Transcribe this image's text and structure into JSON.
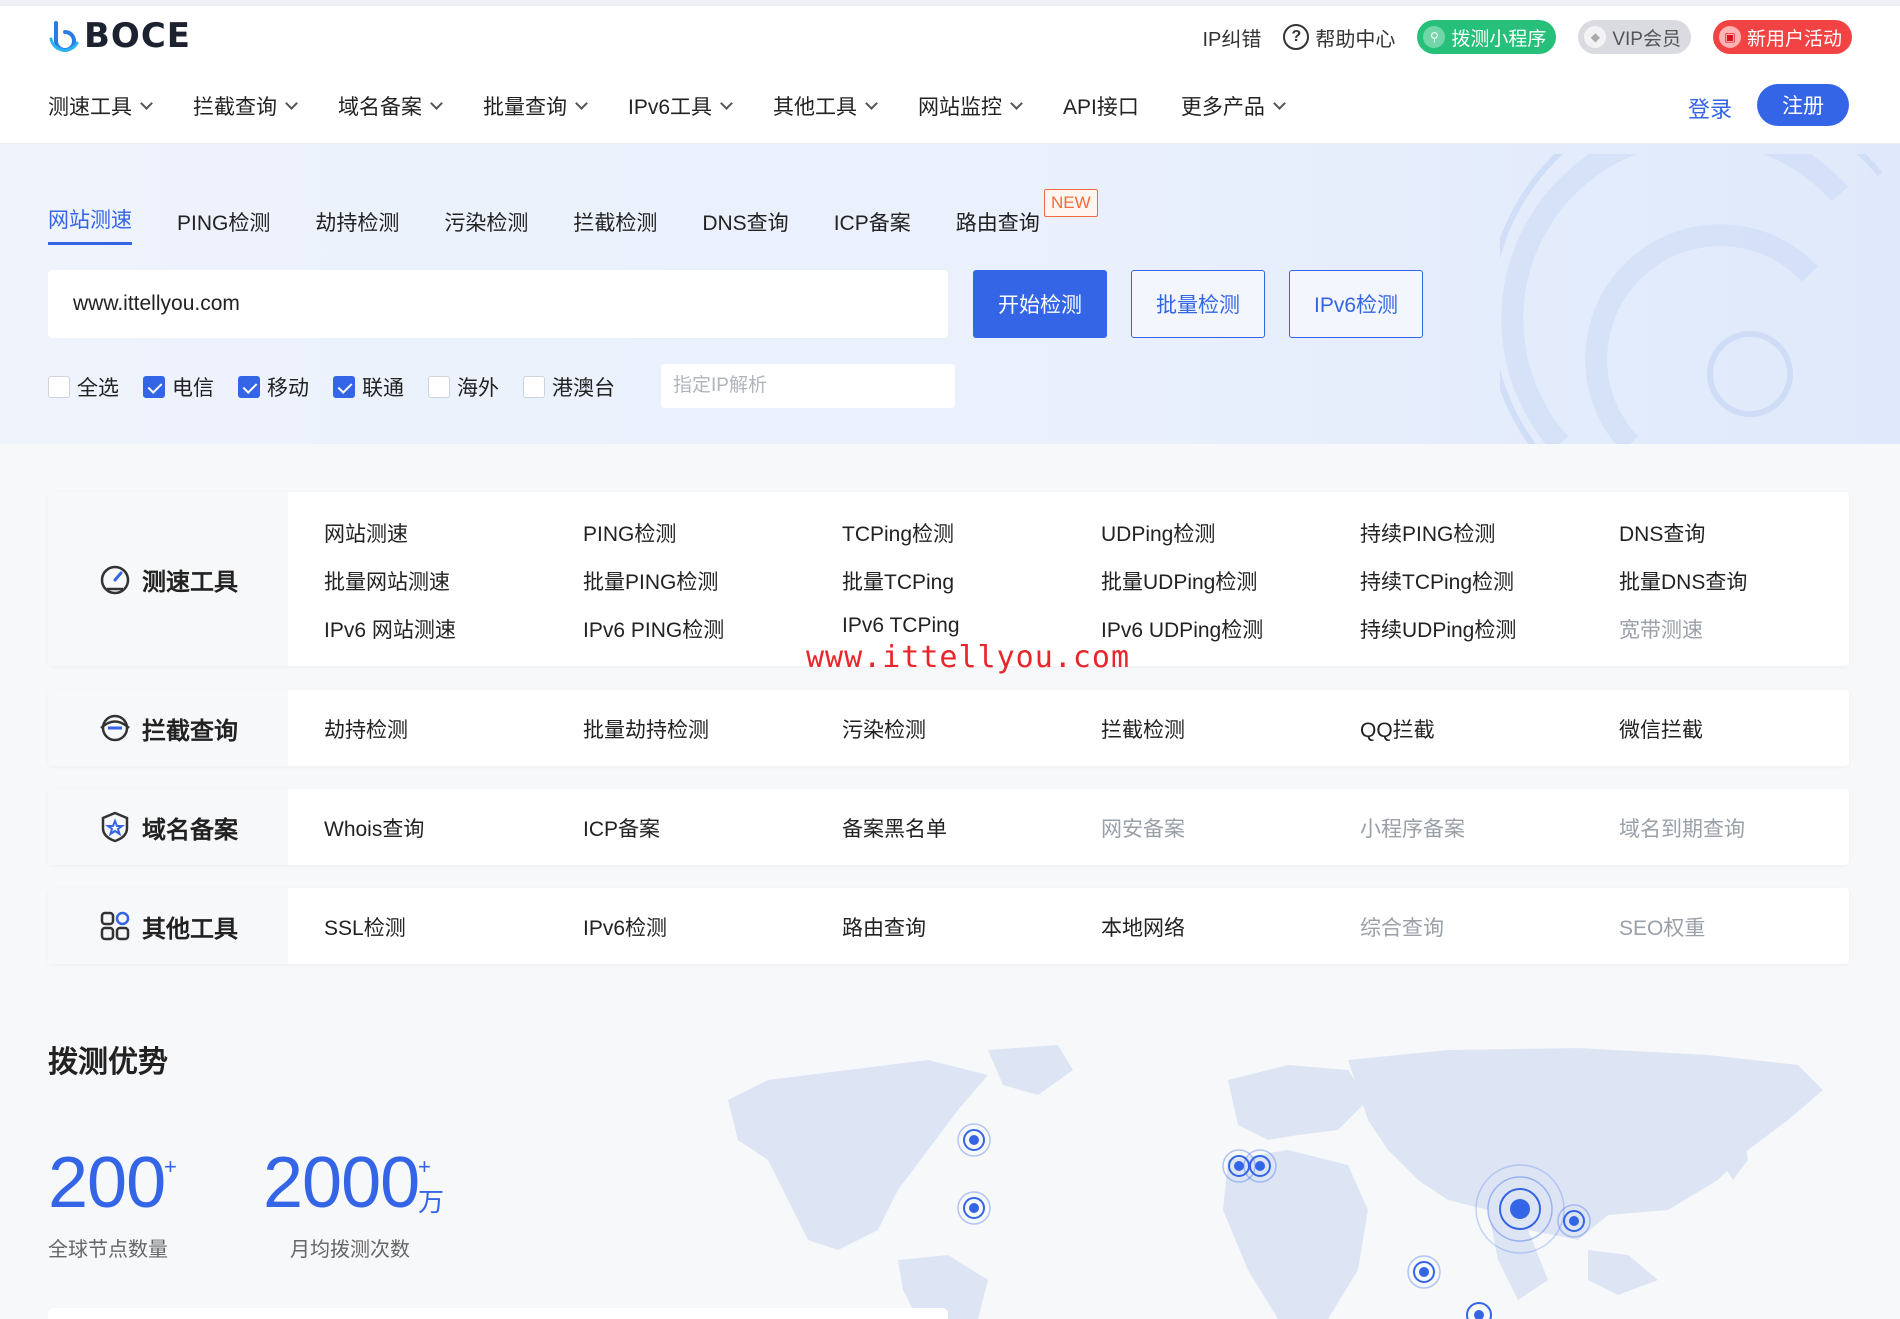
{
  "brand": {
    "logo_text": "BOCE"
  },
  "top_links": {
    "ip_correction": "IP纠错",
    "help_center": "帮助中心",
    "mini_program": "拨测小程序",
    "vip": "VIP会员",
    "new_user": "新用户活动"
  },
  "nav": {
    "items": [
      "测速工具",
      "拦截查询",
      "域名备案",
      "批量查询",
      "IPv6工具",
      "其他工具",
      "网站监控",
      "API接口",
      "更多产品"
    ],
    "login": "登录",
    "register": "注册"
  },
  "hero": {
    "tabs": [
      "网站测速",
      "PING检测",
      "劫持检测",
      "污染检测",
      "拦截检测",
      "DNS查询",
      "ICP备案",
      "路由查询"
    ],
    "active_tab": "网站测速",
    "new_badge": "NEW",
    "search_value": "www.ittellyou.com",
    "start_button": "开始检测",
    "batch_button": "批量检测",
    "ipv6_button": "IPv6检测",
    "checkboxes": [
      {
        "label": "全选",
        "checked": false
      },
      {
        "label": "电信",
        "checked": true
      },
      {
        "label": "移动",
        "checked": true
      },
      {
        "label": "联通",
        "checked": true
      },
      {
        "label": "海外",
        "checked": false
      },
      {
        "label": "港澳台",
        "checked": false
      }
    ],
    "ip_placeholder": "指定IP解析"
  },
  "categories": {
    "speed": {
      "title": "测速工具",
      "rows": [
        [
          "网站测速",
          "PING检测",
          "TCPing检测",
          "UDPing检测",
          "持续PING检测",
          "DNS查询"
        ],
        [
          "批量网站测速",
          "批量PING检测",
          "批量TCPing",
          "批量UDPing检测",
          "持续TCPing检测",
          "批量DNS查询"
        ],
        [
          "IPv6 网站测速",
          "IPv6 PING检测",
          "IPv6 TCPing",
          "IPv6 UDPing检测",
          "持续UDPing检测",
          "宽带测速"
        ]
      ]
    },
    "intercept": {
      "title": "拦截查询",
      "items": [
        "劫持检测",
        "批量劫持检测",
        "污染检测",
        "拦截检测",
        "QQ拦截",
        "微信拦截"
      ]
    },
    "domain": {
      "title": "域名备案",
      "items": [
        "Whois查询",
        "ICP备案",
        "备案黑名单",
        "网安备案",
        "小程序备案",
        "域名到期查询"
      ]
    },
    "other": {
      "title": "其他工具",
      "items": [
        "SSL检测",
        "IPv6检测",
        "路由查询",
        "本地网络",
        "综合查询",
        "SEO权重"
      ]
    }
  },
  "watermark": "www.ittellyou.com",
  "advantage": {
    "title": "拨测优势",
    "stats": [
      {
        "value": "200",
        "suffix": "+",
        "label": "全球节点数量"
      },
      {
        "value": "2000",
        "suffix": "+",
        "unit": "万",
        "label": "月均拨测次数"
      }
    ]
  },
  "colors": {
    "accent": "#3465e6",
    "badge": "#f36b3d",
    "watermark": "#e8262b"
  }
}
